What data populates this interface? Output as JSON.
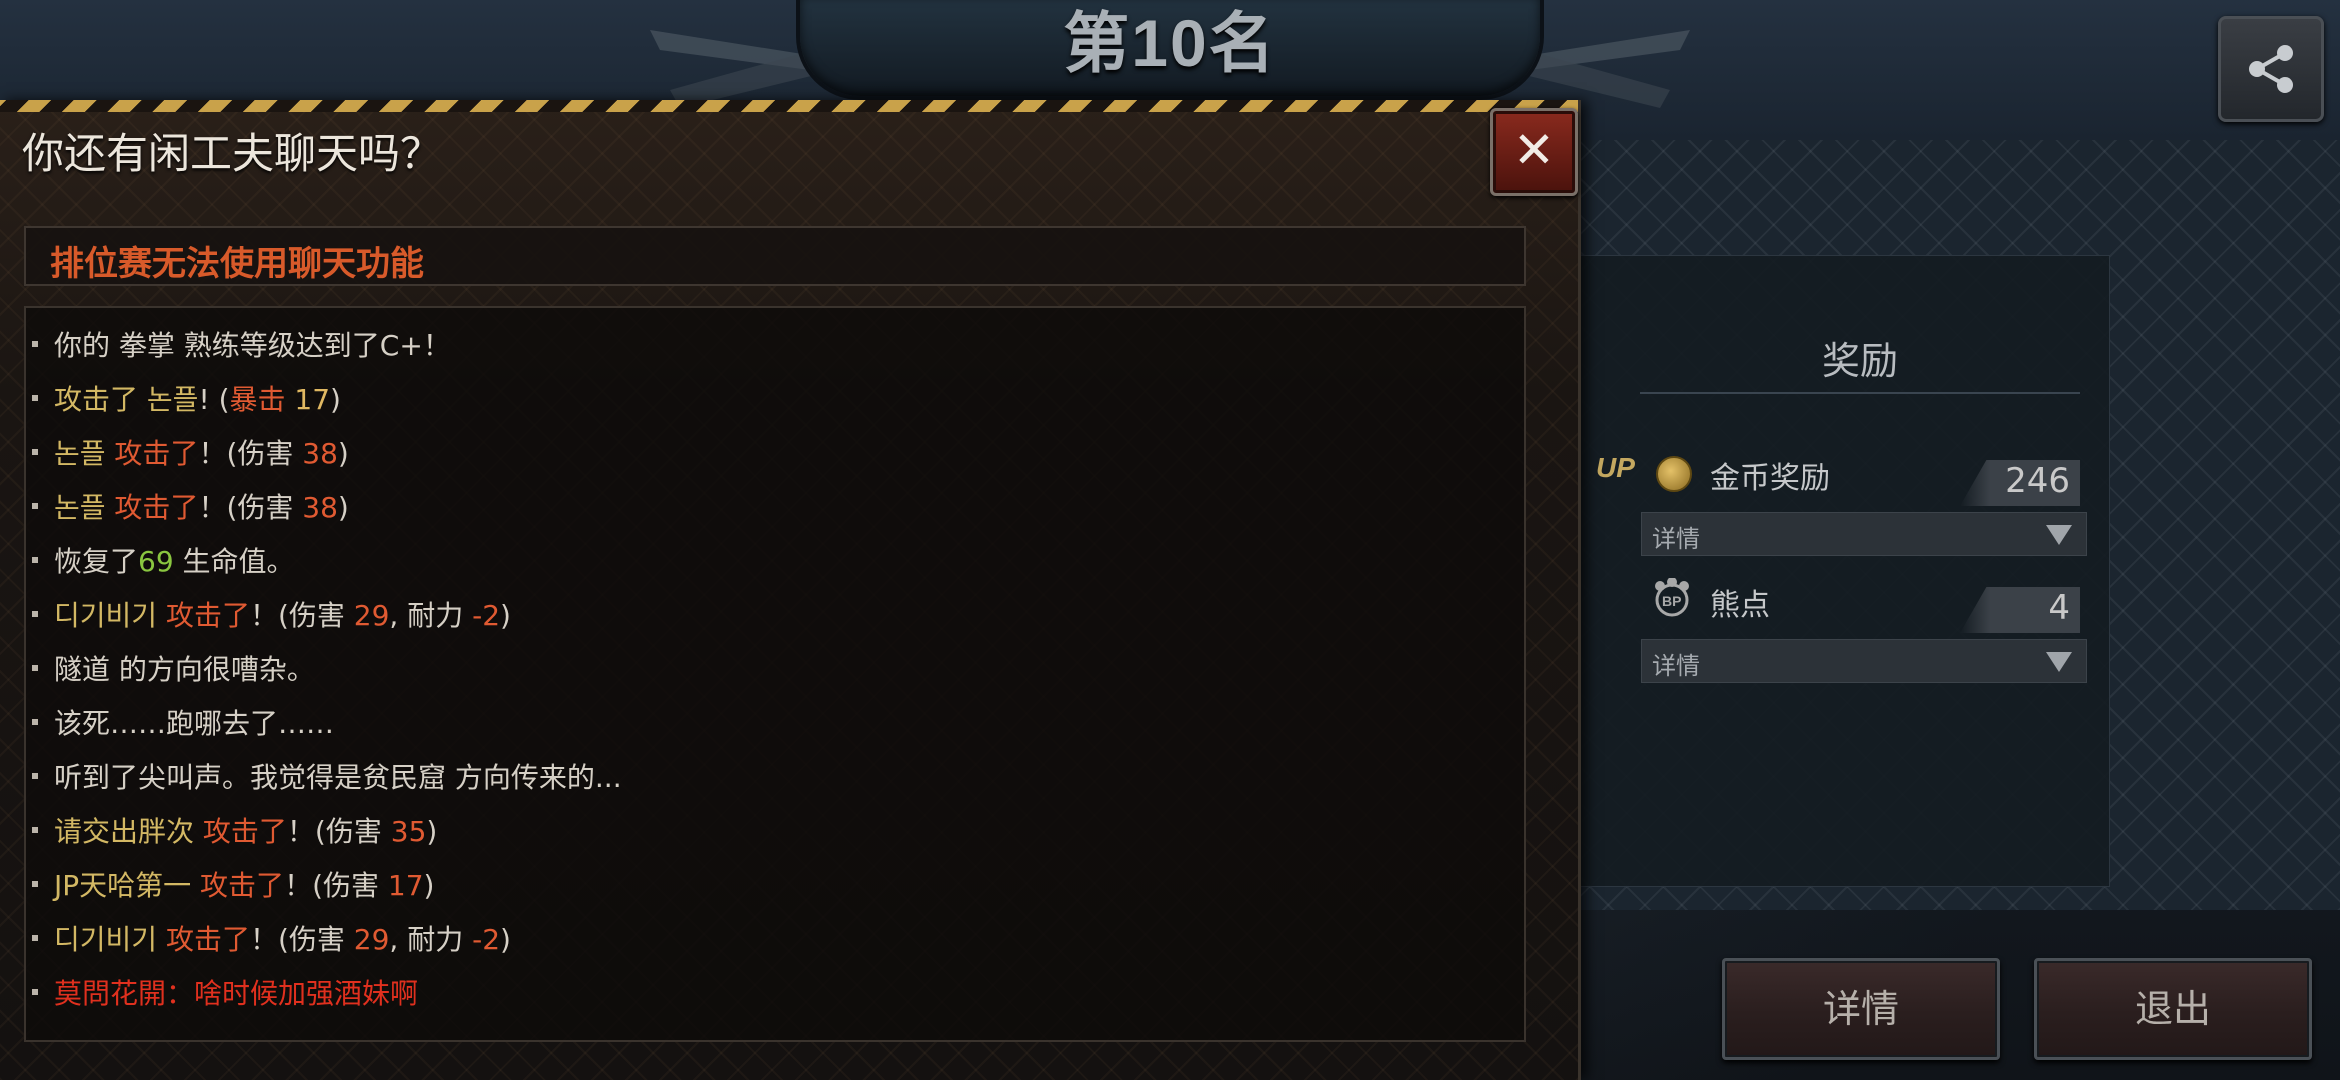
{
  "header": {
    "rank_title": "第10名"
  },
  "share": {
    "icon": "share-icon"
  },
  "reward": {
    "title": "奖励",
    "items": [
      {
        "label": "金币奖励",
        "value": "246",
        "detail": "详情",
        "badge": "UP"
      },
      {
        "label": "熊点",
        "value": "4",
        "detail": "详情"
      }
    ]
  },
  "buttons": {
    "details": "详情",
    "exit": "退出"
  },
  "chat": {
    "title": "你还有闲工夫聊天吗？",
    "close": "✕",
    "notice": "排位赛无法使用聊天功能",
    "lines": [
      {
        "segments": [
          {
            "text": "你的 拳掌 熟练等级达到了C+！",
            "color": "white"
          }
        ]
      },
      {
        "segments": [
          {
            "text": "攻击了 ",
            "color": "gold"
          },
          {
            "text": "논플",
            "color": "gold"
          },
          {
            "text": "! (",
            "color": "white"
          },
          {
            "text": "暴击 ",
            "color": "red"
          },
          {
            "text": "17",
            "color": "num"
          },
          {
            "text": ")",
            "color": "white"
          }
        ]
      },
      {
        "segments": [
          {
            "text": "논플",
            "color": "gold"
          },
          {
            "text": "  攻击了",
            "color": "red"
          },
          {
            "text": "！(伤害 ",
            "color": "white"
          },
          {
            "text": "38",
            "color": "red"
          },
          {
            "text": ")",
            "color": "white"
          }
        ]
      },
      {
        "segments": [
          {
            "text": "논플",
            "color": "gold"
          },
          {
            "text": "  攻击了",
            "color": "red"
          },
          {
            "text": "！(伤害 ",
            "color": "white"
          },
          {
            "text": "38",
            "color": "red"
          },
          {
            "text": ")",
            "color": "white"
          }
        ]
      },
      {
        "segments": [
          {
            "text": "恢复了",
            "color": "white"
          },
          {
            "text": "69",
            "color": "green"
          },
          {
            "text": " 生命值。",
            "color": "white"
          }
        ]
      },
      {
        "segments": [
          {
            "text": "디기비기",
            "color": "gold"
          },
          {
            "text": "  攻击了",
            "color": "red"
          },
          {
            "text": "！(伤害 ",
            "color": "white"
          },
          {
            "text": "29",
            "color": "red"
          },
          {
            "text": ",  耐力  ",
            "color": "white"
          },
          {
            "text": "-2",
            "color": "red"
          },
          {
            "text": ")",
            "color": "white"
          }
        ]
      },
      {
        "segments": [
          {
            "text": "隧道 的方向很嘈杂。",
            "color": "white"
          }
        ]
      },
      {
        "segments": [
          {
            "text": "该死……跑哪去了……",
            "color": "white"
          }
        ]
      },
      {
        "segments": [
          {
            "text": "听到了尖叫声。我觉得是贫民窟 方向传来的...",
            "color": "white"
          }
        ]
      },
      {
        "segments": [
          {
            "text": "请交出胖次",
            "color": "gold"
          },
          {
            "text": "  攻击了",
            "color": "red"
          },
          {
            "text": "！(伤害 ",
            "color": "white"
          },
          {
            "text": "35",
            "color": "red"
          },
          {
            "text": ")",
            "color": "white"
          }
        ]
      },
      {
        "segments": [
          {
            "text": "JP天哈第一",
            "color": "gold"
          },
          {
            "text": "  攻击了",
            "color": "red"
          },
          {
            "text": "！(伤害 ",
            "color": "white"
          },
          {
            "text": "17",
            "color": "red"
          },
          {
            "text": ")",
            "color": "white"
          }
        ]
      },
      {
        "segments": [
          {
            "text": "디기비기",
            "color": "gold"
          },
          {
            "text": "  攻击了",
            "color": "red"
          },
          {
            "text": "！(伤害 ",
            "color": "white"
          },
          {
            "text": "29",
            "color": "red"
          },
          {
            "text": ",  耐力  ",
            "color": "white"
          },
          {
            "text": "-2",
            "color": "red"
          },
          {
            "text": ")",
            "color": "white"
          }
        ]
      },
      {
        "segments": [
          {
            "text": "莫問花開：啥时候加强酒妹啊",
            "color": "crimson"
          }
        ]
      }
    ]
  },
  "colors": {
    "gold": "#d3b864",
    "red": "#e05a32",
    "num": "#e0b862",
    "white": "#d6d0c6",
    "green": "#8ac640",
    "crimson": "#e0301e",
    "hazard": "#c9a24a"
  }
}
